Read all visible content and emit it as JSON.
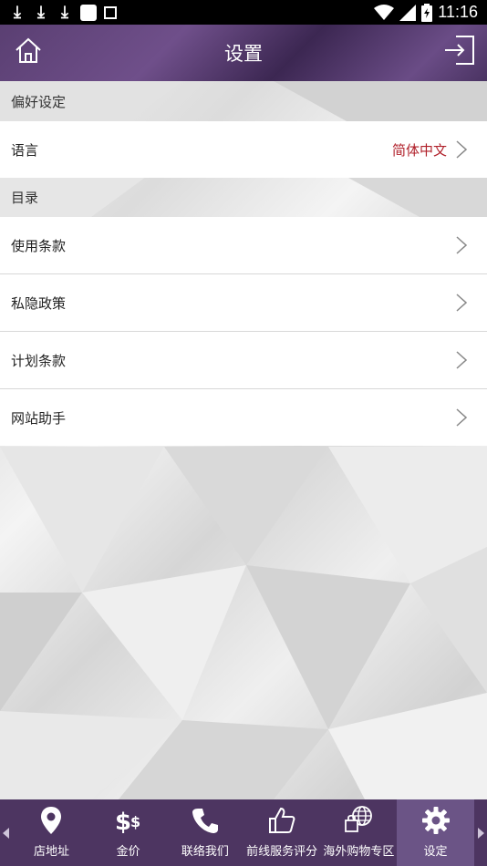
{
  "status_bar": {
    "time": "11:16"
  },
  "header": {
    "title": "设置"
  },
  "sections": [
    {
      "title": "偏好设定"
    },
    {
      "title": "目录"
    }
  ],
  "rows": {
    "language": {
      "label": "语言",
      "value": "简体中文"
    },
    "terms_of_use": {
      "label": "使用条款"
    },
    "privacy_policy": {
      "label": "私隐政策"
    },
    "plan_terms": {
      "label": "计划条款"
    },
    "site_helper": {
      "label": "网站助手"
    }
  },
  "tabs": [
    {
      "label": "店地址",
      "icon": "location-pin-icon"
    },
    {
      "label": "金价",
      "icon": "dollar-icon"
    },
    {
      "label": "联络我们",
      "icon": "phone-icon"
    },
    {
      "label": "前线服务评分",
      "icon": "thumbs-up-icon"
    },
    {
      "label": "海外购物专区",
      "icon": "globe-bag-icon"
    },
    {
      "label": "设定",
      "icon": "gear-icon",
      "active": true
    }
  ],
  "colors": {
    "header": "#5a3f72",
    "tabbar": "#4d3561",
    "tab_active": "#6b5486",
    "value_text": "#b0202a"
  }
}
